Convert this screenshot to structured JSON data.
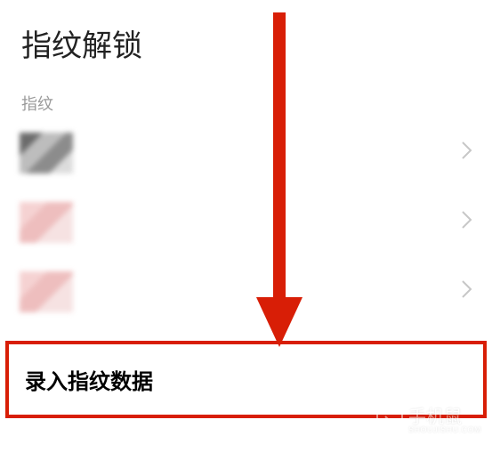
{
  "page": {
    "title": "指纹解锁",
    "section_label": "指纹"
  },
  "fingerprints": [
    {
      "thumb_style": "gray"
    },
    {
      "thumb_style": "pink"
    },
    {
      "thumb_style": "pink"
    }
  ],
  "add_row": {
    "label": "录入指纹数据"
  },
  "watermark": {
    "cn": "手机鼠",
    "en": "SHOUJISHU.COM"
  },
  "annotation": {
    "type": "arrow",
    "color": "#d81e06"
  }
}
